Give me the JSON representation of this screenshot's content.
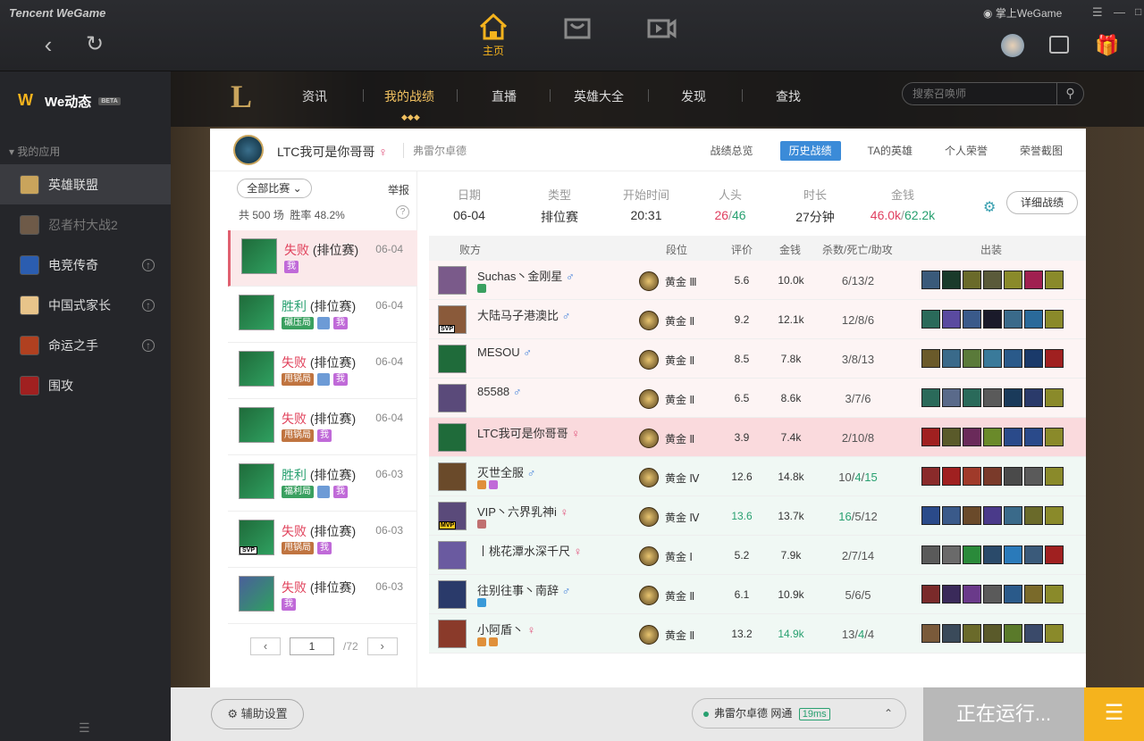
{
  "app": {
    "brand": "Tencent WeGame",
    "mobile_link": "掌上WeGame"
  },
  "topnav": {
    "home": "主页"
  },
  "sidebar": {
    "title": "We动态",
    "beta": "BETA",
    "section": "我的应用",
    "items": [
      {
        "label": "英雄联盟",
        "color": "#c9a45c"
      },
      {
        "label": "忍者村大战2",
        "color": "#6e5a48"
      },
      {
        "label": "电竞传奇",
        "color": "#2b5db0"
      },
      {
        "label": "中国式家长",
        "color": "#e8c48a"
      },
      {
        "label": "命运之手",
        "color": "#b04020"
      },
      {
        "label": "围攻",
        "color": "#a02020"
      }
    ]
  },
  "lol": {
    "tabs": [
      "资讯",
      "我的战绩",
      "直播",
      "英雄大全",
      "发现",
      "查找"
    ],
    "search_placeholder": "搜索召唤师"
  },
  "profile": {
    "name": "LTC我可是你哥哥",
    "server": "弗雷尔卓德",
    "tabs": [
      "战绩总览",
      "历史战绩",
      "TA的英雄",
      "个人荣誉",
      "荣誉截图"
    ]
  },
  "list": {
    "filter": "全部比赛",
    "report": "举报",
    "total_label": "共",
    "total": "500",
    "total_unit": "场",
    "winrate_label": "胜率",
    "winrate": "48.2%",
    "matches": [
      {
        "result": "失败",
        "type": "(排位赛)",
        "date": "06-04",
        "win": false,
        "tags": [
          "我"
        ],
        "color": "#1f6b3a"
      },
      {
        "result": "胜利",
        "type": "(排位赛)",
        "date": "06-04",
        "win": true,
        "tags": [
          "碾压局",
          "pic",
          "我"
        ],
        "color": "#1f6b3a"
      },
      {
        "result": "失败",
        "type": "(排位赛)",
        "date": "06-04",
        "win": false,
        "tags": [
          "甩锅局",
          "pic",
          "我"
        ],
        "color": "#1f6b3a"
      },
      {
        "result": "失败",
        "type": "(排位赛)",
        "date": "06-04",
        "win": false,
        "tags": [
          "甩锅局",
          "我"
        ],
        "color": "#1f6b3a"
      },
      {
        "result": "胜利",
        "type": "(排位赛)",
        "date": "06-03",
        "win": true,
        "tags": [
          "福利局",
          "pic",
          "我"
        ],
        "color": "#1f6b3a"
      },
      {
        "result": "失败",
        "type": "(排位赛)",
        "date": "06-03",
        "win": false,
        "tags": [
          "甩锅局",
          "我"
        ],
        "color": "#1f6b3a",
        "svp": "SVP"
      },
      {
        "result": "失败",
        "type": "(排位赛)",
        "date": "06-03",
        "win": false,
        "tags": [
          "我"
        ],
        "color": "#4a5f9a"
      }
    ],
    "page": "1",
    "pages": "/72"
  },
  "summary": {
    "headers": [
      "日期",
      "类型",
      "开始时间",
      "人头",
      "时长",
      "金钱"
    ],
    "date": "06-04",
    "type": "排位赛",
    "start": "20:31",
    "kills_a": "26",
    "kills_b": "46",
    "duration": "27分钟",
    "gold_a": "46.0k",
    "gold_b": "62.2k",
    "detail": "详细战绩"
  },
  "table": {
    "headers": [
      "败方",
      "段位",
      "评价",
      "金钱",
      "杀数/死亡/助攻",
      "出装"
    ],
    "rows": [
      {
        "name": "Suchas丶金刚星",
        "sex": "♂",
        "male": true,
        "rank": "黄金 Ⅲ",
        "score": "5.6",
        "gold": "10.0k",
        "k": "6",
        "d": "13",
        "a": "2",
        "side": "lose",
        "av": "#7a5a8a",
        "badges": [
          "#3aa060"
        ]
      },
      {
        "name": "大陆马子港澳比",
        "sex": "♂",
        "male": true,
        "rank": "黄金 Ⅱ",
        "score": "9.2",
        "gold": "12.1k",
        "k": "12",
        "d": "8",
        "a": "6",
        "side": "lose",
        "av": "#8a5a3a",
        "svp": "SVP"
      },
      {
        "name": "MESOU",
        "sex": "♂",
        "male": true,
        "rank": "黄金 Ⅱ",
        "score": "8.5",
        "gold": "7.8k",
        "k": "3",
        "d": "8",
        "a": "13",
        "side": "lose",
        "av": "#1f6b3a"
      },
      {
        "name": "85588",
        "sex": "♂",
        "male": true,
        "rank": "黄金 Ⅱ",
        "score": "6.5",
        "gold": "8.6k",
        "k": "3",
        "d": "7",
        "a": "6",
        "side": "lose",
        "av": "#5a4a7a"
      },
      {
        "name": "LTC我可是你哥哥",
        "sex": "♀",
        "male": false,
        "rank": "黄金 Ⅱ",
        "score": "3.9",
        "gold": "7.4k",
        "k": "2",
        "d": "10",
        "a": "8",
        "side": "me",
        "av": "#1f6b3a"
      },
      {
        "name": "灭世全服",
        "sex": "♂",
        "male": true,
        "rank": "黄金 Ⅳ",
        "score": "12.6",
        "gold": "14.8k",
        "k": "10",
        "d": "4",
        "a": "15",
        "side": "win",
        "av": "#6a4a2a",
        "badges": [
          "#e0903a",
          "#c06ad8"
        ],
        "hl": "da"
      },
      {
        "name": "VIP丶六界乳神i",
        "sex": "♀",
        "male": false,
        "rank": "黄金 Ⅳ",
        "score": "13.6",
        "gold": "13.7k",
        "k": "16",
        "d": "5",
        "a": "12",
        "side": "win",
        "av": "#5a4a7a",
        "mvp": "MVP",
        "badges": [
          "#c07070"
        ],
        "hl": "sk"
      },
      {
        "name": "丨桃花潭水深千尺",
        "sex": "♀",
        "male": false,
        "rank": "黄金 Ⅰ",
        "score": "5.2",
        "gold": "7.9k",
        "k": "2",
        "d": "7",
        "a": "14",
        "side": "win",
        "av": "#6a5aa0"
      },
      {
        "name": "往别往事丶南辞",
        "sex": "♂",
        "male": true,
        "rank": "黄金 Ⅱ",
        "score": "6.1",
        "gold": "10.9k",
        "k": "5",
        "d": "6",
        "a": "5",
        "side": "win",
        "av": "#2a3a6a",
        "badges": [
          "#3a9ad8"
        ]
      },
      {
        "name": "小阿盾丶",
        "sex": "♀",
        "male": false,
        "rank": "黄金 Ⅱ",
        "score": "13.2",
        "gold": "14.9k",
        "k": "13",
        "d": "4",
        "a": "4",
        "side": "win",
        "av": "#8a3a2a",
        "badges": [
          "#e0903a",
          "#e0903a"
        ],
        "hl": "ga"
      }
    ],
    "item_colors": [
      [
        "#3a5a7a",
        "#1a3a2a",
        "#6a6a2a",
        "#5a5a3a",
        "#8a8a2a",
        "#a02050",
        "#8a8a2a"
      ],
      [
        "#2a6a5a",
        "#5a4aa0",
        "#3a5a8a",
        "#1a1a2a",
        "#3a6a8a",
        "#2a6a9a",
        "#8a8a2a"
      ],
      [
        "#6a5a2a",
        "#3a6a8a",
        "#5a7a3a",
        "#3a7a9a",
        "#2a5a8a",
        "#1a3a6a",
        "#a02020"
      ],
      [
        "#2a6a5a",
        "#5a6a8a",
        "#2a6a5a",
        "#5a5a5a",
        "#1a3a5a",
        "#2a3a6a",
        "#8a8a2a"
      ],
      [
        "#a02020",
        "#5a5a2a",
        "#6a2a5a",
        "#6a8a2a",
        "#2a4a8a",
        "#2a4a8a",
        "#8a8a2a"
      ],
      [
        "#8a2a2a",
        "#a02020",
        "#a03a2a",
        "#7a3a2a",
        "#4a4a4a",
        "#5a5a5a",
        "#8a8a2a"
      ],
      [
        "#2a4a8a",
        "#3a5a8a",
        "#6a4a2a",
        "#4a3a8a",
        "#3a6a8a",
        "#6a6a2a",
        "#8a8a2a"
      ],
      [
        "#5a5a5a",
        "#6a6a6a",
        "#2a8a3a",
        "#2a4a6a",
        "#2a7aba",
        "#3a5a7a",
        "#a02020"
      ],
      [
        "#7a2a2a",
        "#3a2a5a",
        "#6a3a8a",
        "#5a5a5a",
        "#2a5a8a",
        "#7a6a2a",
        "#8a8a2a"
      ],
      [
        "#7a5a3a",
        "#3a4a5a",
        "#6a6a2a",
        "#5a5a2a",
        "#5a7a2a",
        "#3a4a6a",
        "#8a8a2a"
      ]
    ]
  },
  "bottom": {
    "aux": "辅助设置",
    "server": "弗雷尔卓德",
    "network": "网通",
    "ping": "19ms",
    "running": "正在运行..."
  }
}
